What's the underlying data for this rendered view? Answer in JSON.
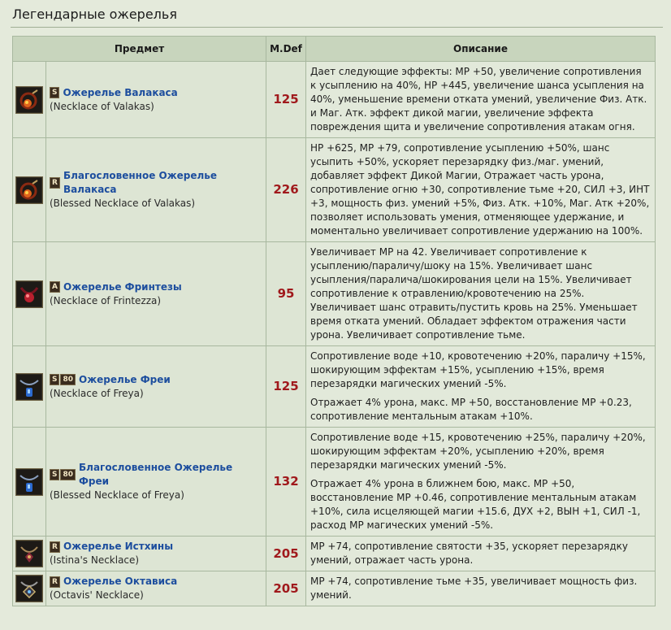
{
  "title": "Легендарные ожерелья",
  "columns": {
    "item": "Предмет",
    "mdef": "M.Def",
    "desc": "Описание"
  },
  "rows": [
    {
      "grade": "S",
      "grade2": "",
      "name": "Ожерелье Валакаса",
      "eng": "(Necklace of Valakas)",
      "mdef": "125",
      "icon": "valakas-necklace-icon",
      "desc": [
        "Дает следующие эффекты: MP +50, увеличение сопротивления к усыплению на 40%, HP +445, увеличение шанса усыпления на 40%, уменьшение времени отката умений, увеличение Физ. Атк. и Маг. Атк. эффект дикой магии, увеличение эффекта повреждения щита и увеличение сопротивления атакам огня."
      ]
    },
    {
      "grade": "R",
      "grade2": "",
      "name": "Благословенное Ожерелье Валакаса",
      "eng": "(Blessed Necklace of Valakas)",
      "mdef": "226",
      "icon": "blessed-valakas-necklace-icon",
      "desc": [
        "HP +625, MP +79, сопротивление усыплению +50%, шанс усыпить +50%, ускоряет перезарядку физ./маг. умений, добавляет эффект Дикой Магии, Отражает часть урона, сопротивление огню +30, сопротивление тьме +20, СИЛ +3, ИНТ +3, мощность физ. умений +5%, Физ. Атк. +10%, Маг. Атк +20%, позволяет использовать умения, отменяющее удержание, и моментально увеличивает сопротивление удержанию на 100%."
      ]
    },
    {
      "grade": "A",
      "grade2": "",
      "name": "Ожерелье Фринтезы",
      "eng": "(Necklace of Frintezza)",
      "mdef": "95",
      "icon": "frintezza-necklace-icon",
      "desc": [
        "Увеличивает MP на 42. Увеличивает сопротивление к усыплению/параличу/шоку на 15%. Увеличивает шанс усыпления/паралича/шокирования цели на 15%. Увеличивает сопротивление к отравлению/кровотечению на 25%. Увеличивает шанс отравить/пустить кровь на 25%. Уменьшает время отката умений. Обладает эффектом отражения части урона. Увеличивает сопротивление тьме."
      ]
    },
    {
      "grade": "S",
      "grade2": "80",
      "name": "Ожерелье Фреи",
      "eng": "(Necklace of Freya)",
      "mdef": "125",
      "icon": "freya-necklace-icon",
      "desc": [
        "Сопротивление воде +10, кровотечению +20%, параличу +15%, шокирующим эффектам +15%, усыплению +15%, время перезарядки магических умений -5%.",
        "Отражает 4% урона, макс. MP +50, восстановление MP +0.23, сопротивление ментальным атакам +10%."
      ]
    },
    {
      "grade": "S",
      "grade2": "80",
      "name": "Благословенное Ожерелье Фреи",
      "eng": "(Blessed Necklace of Freya)",
      "mdef": "132",
      "icon": "blessed-freya-necklace-icon",
      "desc": [
        "Сопротивление воде +15, кровотечению +25%, параличу +20%, шокирующим эффектам +20%, усыплению +20%, время перезарядки магических умений -5%.",
        "Отражает 4% урона в ближнем бою, макс. MP +50, восстановление MP +0.46, сопротивление ментальным атакам +10%, сила исцеляющей магии +15.6, ДУХ +2, ВЫН +1, СИЛ -1, расход MP магических умений -5%."
      ]
    },
    {
      "grade": "R",
      "grade2": "",
      "name": "Ожерелье Истхины",
      "eng": "(Istina's Necklace)",
      "mdef": "205",
      "icon": "istina-necklace-icon",
      "desc": [
        "MP +74, сопротивление святости +35, ускоряет перезарядку умений, отражает часть урона."
      ]
    },
    {
      "grade": "R",
      "grade2": "",
      "name": "Ожерелье Октависа",
      "eng": "(Octavis' Necklace)",
      "mdef": "205",
      "icon": "octavis-necklace-icon",
      "desc": [
        "MP +74, сопротивление тьме +35, увеличивает мощность физ. умений."
      ]
    }
  ]
}
